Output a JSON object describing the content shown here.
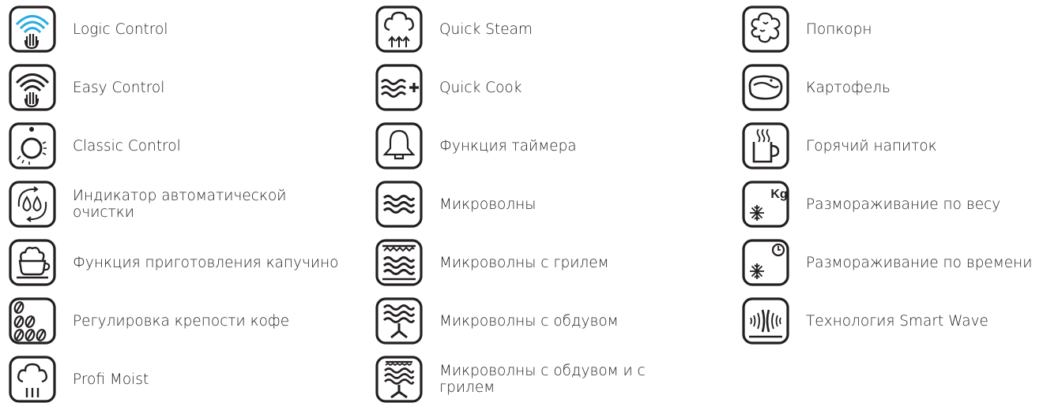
{
  "colors": {
    "ink": "#231f20",
    "accent": "#29abe2",
    "background": "#ffffff"
  },
  "columns": [
    {
      "items": [
        {
          "icon": "logic-control-icon",
          "label": "Logic Control"
        },
        {
          "icon": "easy-control-icon",
          "label": "Easy Control"
        },
        {
          "icon": "classic-control-icon",
          "label": "Classic Control"
        },
        {
          "icon": "auto-clean-indicator-icon",
          "label": "Индикатор автоматической очистки"
        },
        {
          "icon": "cappuccino-icon",
          "label": "Функция приготовления капучино"
        },
        {
          "icon": "coffee-strength-icon",
          "label": "Регулировка крепости кофе"
        },
        {
          "icon": "profi-moist-icon",
          "label": "Profi  Moist"
        }
      ]
    },
    {
      "items": [
        {
          "icon": "quick-steam-icon",
          "label": "Quick Steam"
        },
        {
          "icon": "quick-cook-icon",
          "label": "Quick Cook"
        },
        {
          "icon": "timer-bell-icon",
          "label": "Функция таймера"
        },
        {
          "icon": "microwave-icon",
          "label": "Микроволны"
        },
        {
          "icon": "microwave-grill-icon",
          "label": "Микроволны с грилем"
        },
        {
          "icon": "microwave-convection-icon",
          "label": "Микроволны с обдувом"
        },
        {
          "icon": "microwave-convection-grill-icon",
          "label": "Микроволны с обдувом и с грилем"
        }
      ]
    },
    {
      "items": [
        {
          "icon": "popcorn-icon",
          "label": "Попкорн"
        },
        {
          "icon": "potato-icon",
          "label": "Картофель"
        },
        {
          "icon": "hot-drink-icon",
          "label": "Горячий напиток"
        },
        {
          "icon": "defrost-weight-icon",
          "label": "Размораживание по весу"
        },
        {
          "icon": "defrost-time-icon",
          "label": "Размораживание по времени"
        },
        {
          "icon": "smart-wave-icon",
          "label": "Технология Smart Wave"
        }
      ]
    }
  ],
  "icon_text": {
    "kg": "Kg"
  }
}
